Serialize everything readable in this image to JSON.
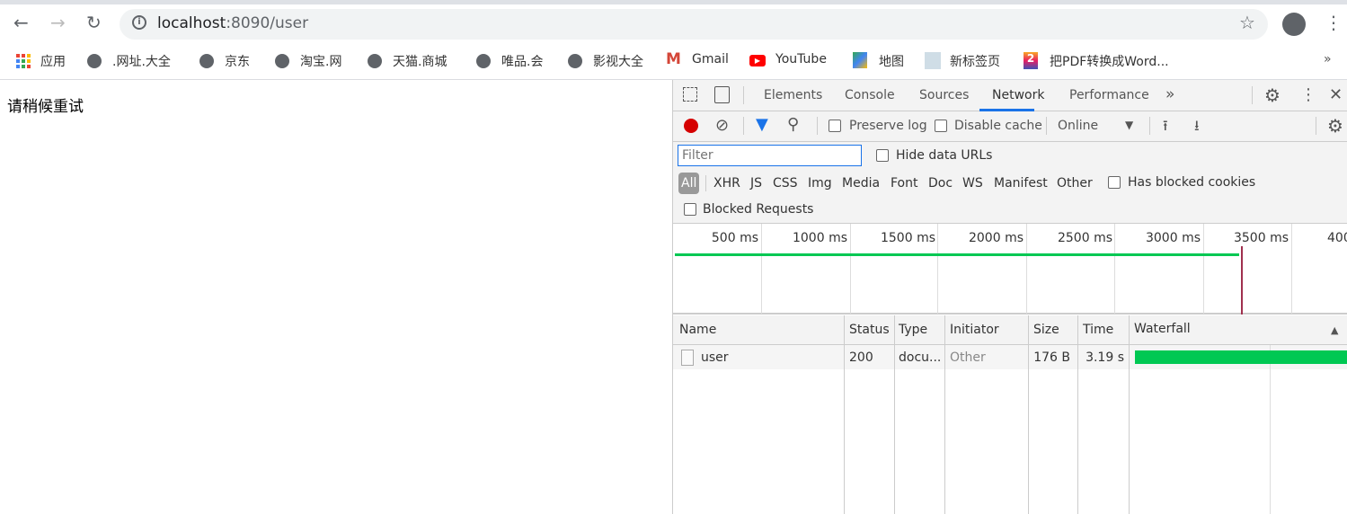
{
  "browser": {
    "url_host": "localhost",
    "url_rest": ":8090/user"
  },
  "bookmarks": [
    {
      "label": "应用",
      "icon": "apps-grid-icon"
    },
    {
      "label": ".网址.大全",
      "icon": "globe-icon"
    },
    {
      "label": "京东",
      "icon": "globe-icon"
    },
    {
      "label": "淘宝.网",
      "icon": "globe-icon"
    },
    {
      "label": "天猫.商城",
      "icon": "globe-icon"
    },
    {
      "label": "唯品.会",
      "icon": "globe-icon"
    },
    {
      "label": "影视大全",
      "icon": "globe-icon"
    },
    {
      "label": "Gmail",
      "icon": "gmail-icon"
    },
    {
      "label": "YouTube",
      "icon": "youtube-icon"
    },
    {
      "label": "地图",
      "icon": "maps-icon"
    },
    {
      "label": "新标签页",
      "icon": "page-thumbnail-icon"
    },
    {
      "label": "把PDF转换成Word...",
      "icon": "pdf-icon"
    }
  ],
  "page": {
    "message": "请稍候重试"
  },
  "devtools": {
    "tabs": [
      "Elements",
      "Console",
      "Sources",
      "Network",
      "Performance"
    ],
    "active_tab": "Network",
    "toolbar": {
      "preserve_log": "Preserve log",
      "disable_cache": "Disable cache",
      "throttle": "Online"
    },
    "filter": {
      "placeholder": "Filter",
      "hide_data_urls": "Hide data URLs",
      "has_blocked_cookies": "Has blocked cookies",
      "blocked_requests": "Blocked Requests"
    },
    "types": [
      "All",
      "XHR",
      "JS",
      "CSS",
      "Img",
      "Media",
      "Font",
      "Doc",
      "WS",
      "Manifest",
      "Other"
    ],
    "timeline_ticks": [
      "500 ms",
      "1000 ms",
      "1500 ms",
      "2000 ms",
      "2500 ms",
      "3000 ms",
      "3500 ms",
      "400"
    ],
    "columns": [
      "Name",
      "Status",
      "Type",
      "Initiator",
      "Size",
      "Time",
      "Waterfall"
    ],
    "rows": [
      {
        "name": "user",
        "status": "200",
        "type": "docu...",
        "initiator": "Other",
        "size": "176 B",
        "time": "3.19 s"
      }
    ],
    "colors": {
      "accent": "#1a73e8",
      "record": "#d50000",
      "bar": "#00c853",
      "load_line": "#a0304e"
    }
  }
}
